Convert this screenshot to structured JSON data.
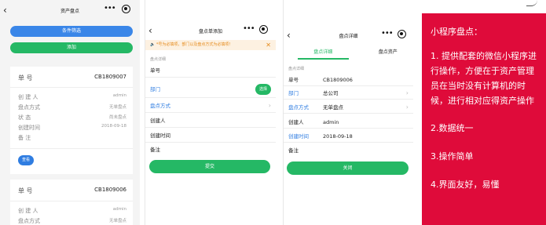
{
  "screen1": {
    "title": "资产盘点",
    "back": "‹",
    "menu": "•••",
    "filter_label": "条件筛选",
    "add_label": "添加",
    "cards": [
      {
        "no_label": "单 号",
        "no_value": "CB1809007",
        "fields": [
          {
            "label": "创 建 人",
            "value": "admin"
          },
          {
            "label": "盘点方式",
            "value": "无单盘点"
          },
          {
            "label": "状 态",
            "value": "尚未盘点"
          },
          {
            "label": "创建时间",
            "value": "2018-09-18"
          },
          {
            "label": "备 注",
            "value": ""
          }
        ],
        "view_label": "查看"
      },
      {
        "no_label": "单 号",
        "no_value": "CB1809006",
        "fields": [
          {
            "label": "创 建 人",
            "value": "admin"
          },
          {
            "label": "盘点方式",
            "value": "无单盘点"
          }
        ]
      }
    ]
  },
  "screen2": {
    "title": "盘点单添加",
    "back": "‹",
    "menu": "•••",
    "warning": "🔈 *号为必填项，部门以及盘点方式为必填项！",
    "warning_close": "✕",
    "section": "盘点详细",
    "rows": [
      {
        "label": "单号"
      },
      {
        "label": "部门",
        "action": "选择"
      },
      {
        "label": "盘点方式"
      },
      {
        "label": "创建人"
      },
      {
        "label": "创建时间"
      },
      {
        "label": "备注"
      }
    ],
    "submit_label": "提交"
  },
  "screen3": {
    "title": "盘点详细",
    "back": "‹",
    "menu": "•••",
    "tabs": [
      "盘点详细",
      "盘点资产"
    ],
    "section": "盘点详细",
    "rows": [
      {
        "label": "单号",
        "value": "CB1809006"
      },
      {
        "label": "部门",
        "value": "总公司"
      },
      {
        "label": "盘点方式",
        "value": "无单盘点"
      },
      {
        "label": "创建人",
        "value": "admin"
      },
      {
        "label": "创建时间",
        "value": "2018-09-18"
      },
      {
        "label": "备注",
        "value": ""
      }
    ],
    "close_label": "关闭"
  },
  "panel": {
    "lines": [
      "小程序盘点：",
      "1. 提供配套的微信小程序进行操作，方便在于资产管理员在当时没有计算机的时候，进行相对应得资产操作",
      "2.数据统一",
      "3.操作简单",
      "4.界面友好，易懂"
    ],
    "background": "#df0b3a"
  },
  "colors": {
    "blue": "#3a86e8",
    "green": "#25b865",
    "warning": "#e58a1b"
  }
}
